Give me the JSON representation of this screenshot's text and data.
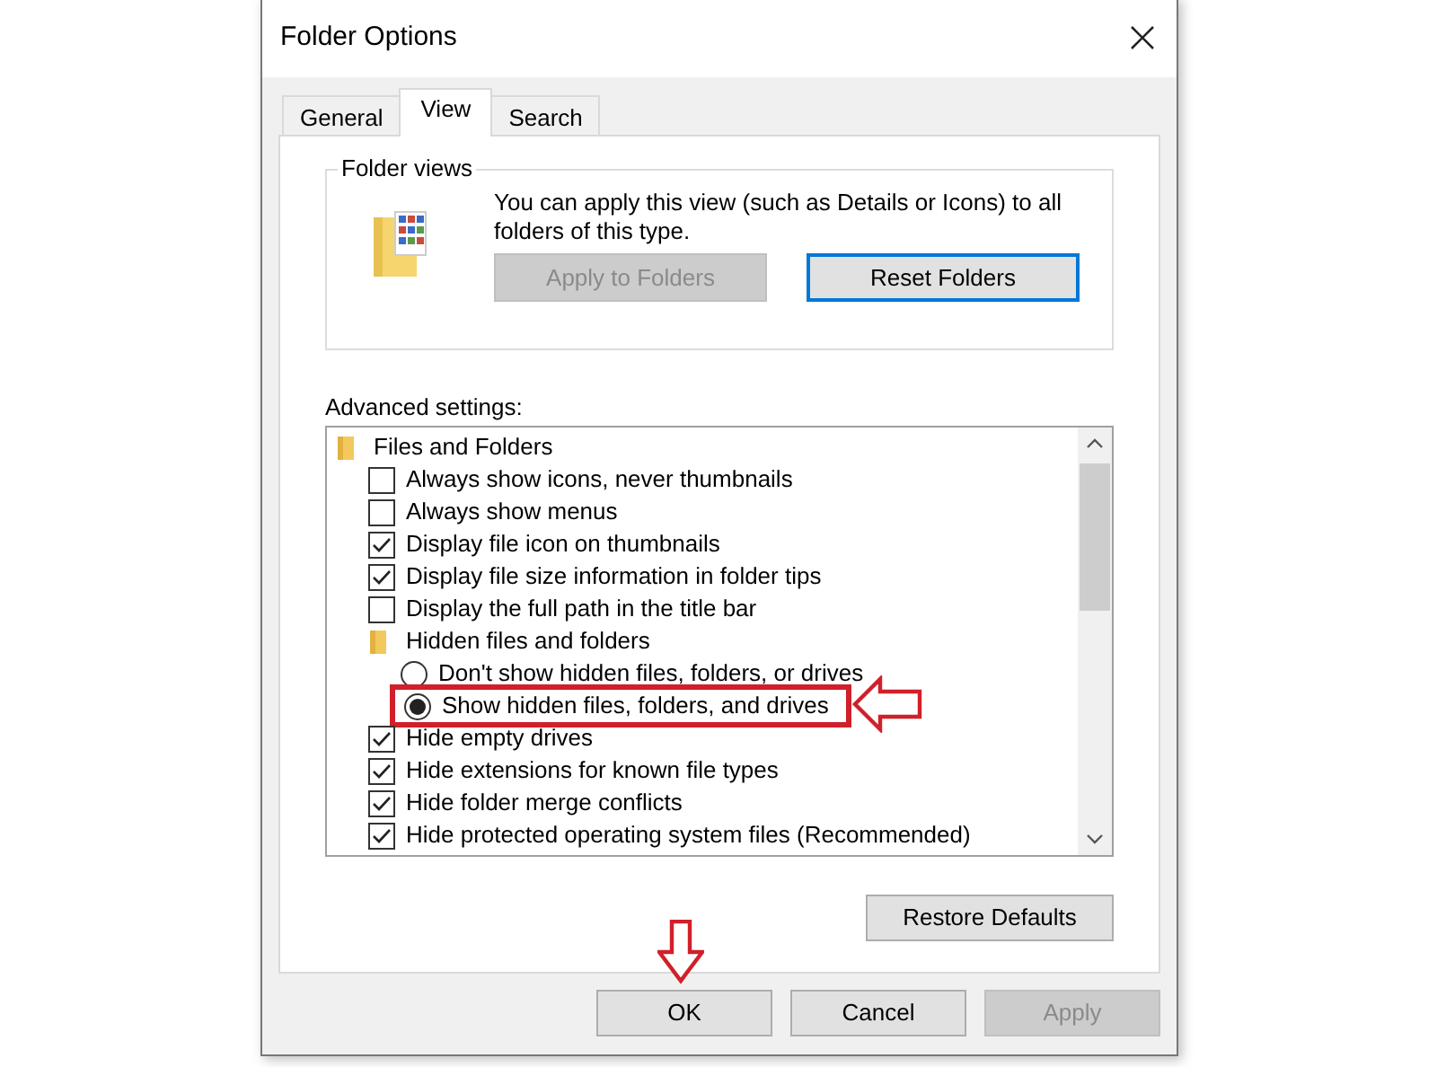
{
  "window": {
    "title": "Folder Options"
  },
  "tabs": [
    {
      "label": "General",
      "selected": false
    },
    {
      "label": "View",
      "selected": true
    },
    {
      "label": "Search",
      "selected": false
    }
  ],
  "folder_views": {
    "legend": "Folder views",
    "description": "You can apply this view (such as Details or Icons) to all folders of this type.",
    "buttons": [
      {
        "label": "Apply to Folders",
        "disabled": true,
        "focused": false
      },
      {
        "label": "Reset Folders",
        "disabled": false,
        "focused": true
      }
    ]
  },
  "advanced_settings": {
    "label": "Advanced settings:",
    "items": [
      {
        "kind": "folder",
        "label": "Files and Folders",
        "children": [
          {
            "kind": "checkbox",
            "label": "Always show icons, never thumbnails",
            "checked": false
          },
          {
            "kind": "checkbox",
            "label": "Always show menus",
            "checked": false
          },
          {
            "kind": "checkbox",
            "label": "Display file icon on thumbnails",
            "checked": true
          },
          {
            "kind": "checkbox",
            "label": "Display file size information in folder tips",
            "checked": true
          },
          {
            "kind": "checkbox",
            "label": "Display the full path in the title bar",
            "checked": false
          },
          {
            "kind": "folder",
            "label": "Hidden files and folders",
            "children": [
              {
                "kind": "radio",
                "label": "Don't show hidden files, folders, or drives",
                "selected": false,
                "highlighted": false
              },
              {
                "kind": "radio",
                "label": "Show hidden files, folders, and drives",
                "selected": true,
                "highlighted": true
              }
            ]
          },
          {
            "kind": "checkbox",
            "label": "Hide empty drives",
            "checked": true
          },
          {
            "kind": "checkbox",
            "label": "Hide extensions for known file types",
            "checked": true
          },
          {
            "kind": "checkbox",
            "label": "Hide folder merge conflicts",
            "checked": true
          },
          {
            "kind": "checkbox",
            "label": "Hide protected operating system files (Recommended)",
            "checked": true
          }
        ]
      }
    ]
  },
  "restore_button": {
    "label": "Restore Defaults"
  },
  "footer_buttons": [
    {
      "label": "OK",
      "disabled": false
    },
    {
      "label": "Cancel",
      "disabled": false
    },
    {
      "label": "Apply",
      "disabled": true
    }
  ]
}
